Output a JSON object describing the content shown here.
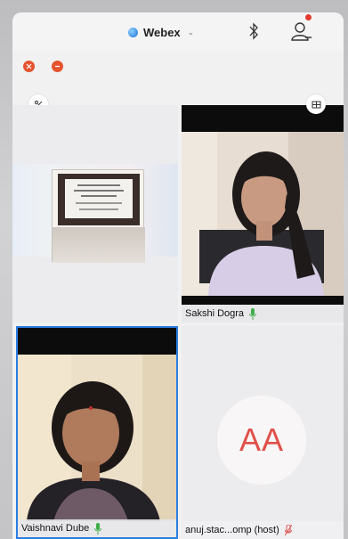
{
  "app": {
    "name": "Webex",
    "icons": {
      "logo": "webex-logo-icon",
      "switcher": "chevron-down-icon",
      "bluetooth": "bluetooth-icon",
      "profile": "profile-icon",
      "notification": "notification-dot-icon"
    }
  },
  "window_controls": [
    "close-icon",
    "minimize-icon"
  ],
  "toolbar": {
    "left_button_icon": "percent-icon",
    "right_button_icon": "grid-view-icon"
  },
  "participants": [
    {
      "id": "share",
      "type": "content-share"
    },
    {
      "id": "sakshi",
      "name": "Sakshi Dogra",
      "mic": "unmuted",
      "mic_color": "#3fae49"
    },
    {
      "id": "vaishnavi",
      "name": "Vaishnavi Dube",
      "mic": "unmuted",
      "mic_color": "#3fae49",
      "active_speaker": true
    },
    {
      "id": "anuj",
      "name": "anuj.stac...omp (host)",
      "initials": "AA",
      "mic": "muted",
      "mic_color": "#e0504a"
    }
  ],
  "colors": {
    "accent": "#2b7de0",
    "close": "#e5532f",
    "avatar_text": "#e0504a"
  }
}
